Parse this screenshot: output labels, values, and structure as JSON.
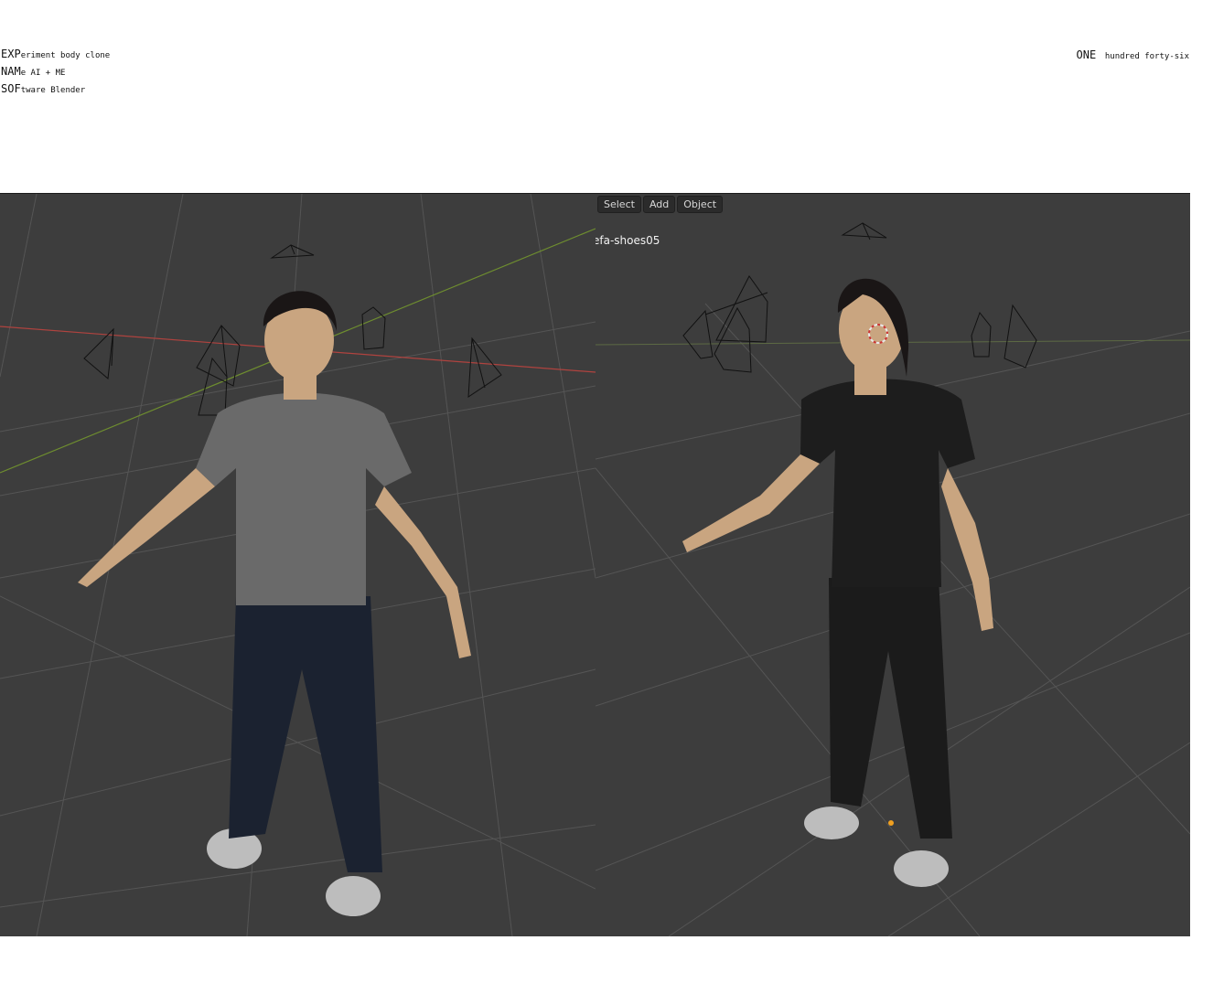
{
  "meta": {
    "experiment": {
      "prefix": "EXP",
      "rest": "eriment body clone"
    },
    "name": {
      "prefix": "NAM",
      "rest": "e AI + ME"
    },
    "software": {
      "prefix": "SOF",
      "rest": "tware Blender"
    }
  },
  "counter": {
    "big": "ONE",
    "small": "hundred forty-six"
  },
  "right_viewport": {
    "menu": {
      "select": "Select",
      "add": "Add",
      "object": "Object"
    },
    "active_object": "efa-shoes05"
  },
  "colors": {
    "viewport_bg": "#3d3d3d",
    "grid": "#555555",
    "x_axis": "#b0433f",
    "y_axis": "#6e8d2f",
    "skin": "#c9a580",
    "hair": "#1a1616",
    "shirt_gray": "#6a6a6a",
    "shirt_black": "#1d1d1d",
    "pants": "#1b2230",
    "shoes": "#bdbdbd"
  }
}
